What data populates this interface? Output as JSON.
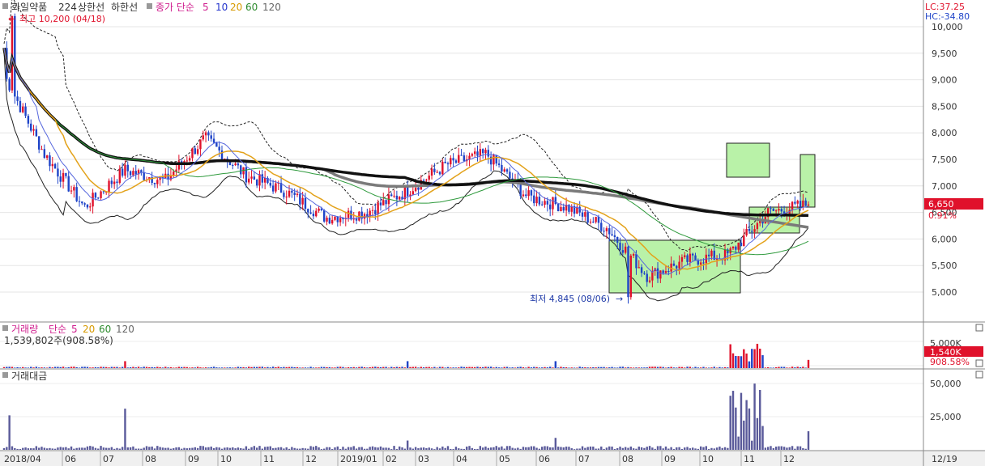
{
  "legend_main": {
    "stock_name": "화일약품",
    "stock_code": "224",
    "upper_limit": "상한선",
    "lower_limit": "하한선",
    "ma_label": "종가 단순",
    "ma_periods": [
      "5",
      "10",
      "20",
      "60",
      "120"
    ],
    "high_marker": "최고 10,200 (04/18)",
    "low_marker": "최저 4,845 (08/06)"
  },
  "legend_volume": {
    "label": "거래량",
    "ma_label": "단순",
    "ma_periods": [
      "5",
      "20",
      "60",
      "120"
    ],
    "current": "1,539,802주(908.58%)"
  },
  "legend_value": {
    "label": "거래대금"
  },
  "right_panel": {
    "lc": "LC:37.25",
    "hc": "HC:-34.80",
    "price_ticks": [
      "10,000",
      "9,500",
      "9,000",
      "8,500",
      "8,000",
      "7,500",
      "7,000",
      "6,500",
      "6,000",
      "5,500",
      "5,000"
    ],
    "current_price": "6,650",
    "current_change": "0.91%",
    "volume_tick": "5,000K",
    "volume_current": "1,540K",
    "volume_ratio": "908.58%",
    "value_ticks": [
      "50,000",
      "25,000"
    ],
    "date_label": "12/19"
  },
  "x_axis": {
    "labels": [
      "2018/04",
      "06",
      "07",
      "08",
      "09",
      "10",
      "11",
      "12",
      "2019/01",
      "02",
      "03",
      "04",
      "05",
      "06",
      "07",
      "08",
      "09",
      "10",
      "11",
      "12"
    ]
  },
  "colors": {
    "up": "#e0112b",
    "down": "#1f44c8",
    "ma5": "#222222",
    "ma10": "#6a6a6a",
    "ma20": "#e3a21a",
    "ma60": "#2e9a3c",
    "ma120": "#111111",
    "highlight_fill": "#b9f2a8",
    "legend_pink": "#d0208f",
    "legend_blue": "#2233cc",
    "legend_orange": "#d79a00",
    "legend_green": "#2e8b2e",
    "legend_gray": "#666666",
    "price_box": "#e0112b"
  },
  "chart_data": {
    "type": "candlestick",
    "y_range": [
      4500,
      10300
    ],
    "high_point": {
      "date": "2018/04/18",
      "value": 10200
    },
    "low_point": {
      "date": "2019/08/06",
      "value": 4845
    },
    "close_points": [
      {
        "date": "2018/04",
        "close": 9100
      },
      {
        "date": "2018/05",
        "close": 7600
      },
      {
        "date": "2018/06",
        "close": 6600
      },
      {
        "date": "2018/07",
        "close": 7300
      },
      {
        "date": "2018/08",
        "close": 7100
      },
      {
        "date": "2018/09",
        "close": 7900
      },
      {
        "date": "2018/10",
        "close": 7200
      },
      {
        "date": "2018/11",
        "close": 6900
      },
      {
        "date": "2018/12",
        "close": 6400
      },
      {
        "date": "2019/01",
        "close": 6500
      },
      {
        "date": "2019/02",
        "close": 6900
      },
      {
        "date": "2019/03",
        "close": 7400
      },
      {
        "date": "2019/04",
        "close": 7600
      },
      {
        "date": "2019/05",
        "close": 6800
      },
      {
        "date": "2019/06",
        "close": 6600
      },
      {
        "date": "2019/07",
        "close": 6200
      },
      {
        "date": "2019/08",
        "close": 5300
      },
      {
        "date": "2019/09",
        "close": 5600
      },
      {
        "date": "2019/10",
        "close": 5700
      },
      {
        "date": "2019/11",
        "close": 6500
      },
      {
        "date": "2019/12",
        "close": 6650
      }
    ],
    "last_close": 6650,
    "last_change_pct": 0.91,
    "volume_last": 1539802,
    "volume_ratio_pct": 908.58
  }
}
